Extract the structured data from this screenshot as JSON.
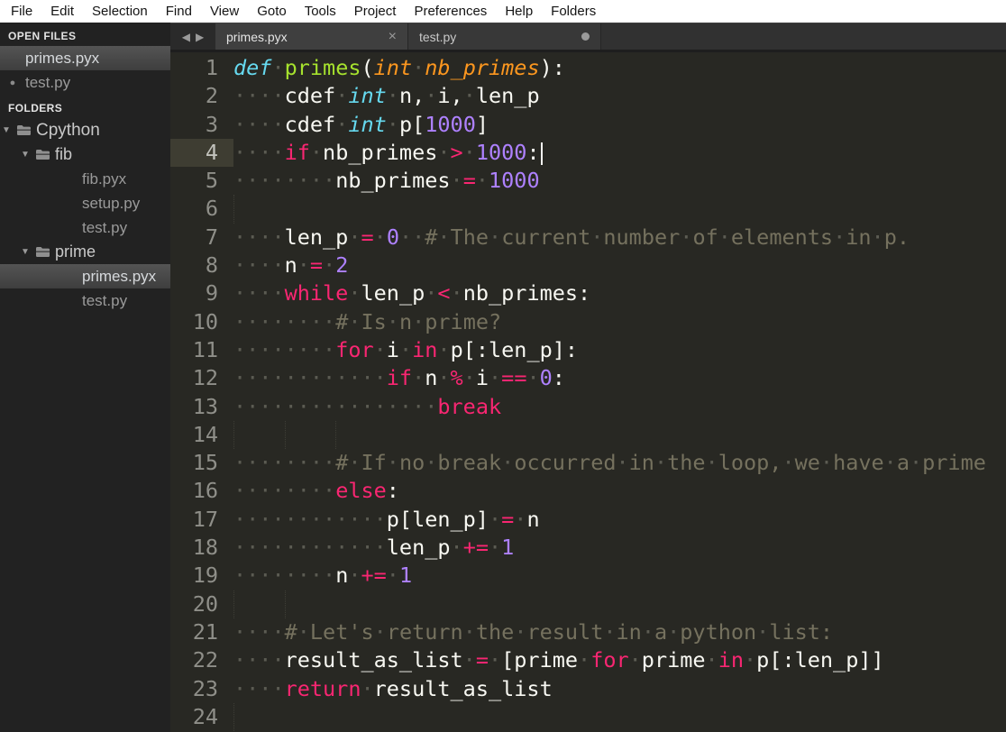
{
  "menu": {
    "items": [
      "File",
      "Edit",
      "Selection",
      "Find",
      "View",
      "Goto",
      "Tools",
      "Project",
      "Preferences",
      "Help",
      "Folders"
    ]
  },
  "icons": {
    "back": "◀",
    "forward": "▶",
    "close": "×",
    "modified_dot": "●",
    "expanded_triangle": "▼",
    "open_file_bullet": "●"
  },
  "sidebar": {
    "open_files_label": "OPEN FILES",
    "open_files": [
      {
        "name": "primes.pyx",
        "selected": true,
        "modified": false
      },
      {
        "name": "test.py",
        "selected": false,
        "modified": true
      }
    ],
    "folders_label": "FOLDERS",
    "tree": [
      {
        "label": "Cpython",
        "type": "folder",
        "depth": 0,
        "expanded": true,
        "selected": false
      },
      {
        "label": "fib",
        "type": "folder",
        "depth": 1,
        "expanded": true,
        "selected": false
      },
      {
        "label": "fib.pyx",
        "type": "file",
        "depth": 2,
        "selected": false
      },
      {
        "label": "setup.py",
        "type": "file",
        "depth": 2,
        "selected": false
      },
      {
        "label": "test.py",
        "type": "file",
        "depth": 2,
        "selected": false
      },
      {
        "label": "prime",
        "type": "folder",
        "depth": 1,
        "expanded": true,
        "selected": false
      },
      {
        "label": "primes.pyx",
        "type": "file",
        "depth": 2,
        "selected": true
      },
      {
        "label": "test.py",
        "type": "file",
        "depth": 2,
        "selected": false
      }
    ]
  },
  "tabs": {
    "items": [
      {
        "label": "primes.pyx",
        "active": true,
        "indicator": "close"
      },
      {
        "label": "test.py",
        "active": false,
        "indicator": "dot"
      }
    ]
  },
  "editor": {
    "file": "primes.pyx",
    "active_line": 4,
    "caret_line": 4,
    "ws_glyph": "·",
    "colors": {
      "background": "#282823",
      "keyword": "#f92672",
      "type_italic": "#66d9ef",
      "function_name": "#a6e22e",
      "parameter": "#fd971f",
      "number": "#ae81ff",
      "foreground": "#f8f8f2",
      "comment": "#75715e"
    },
    "lines": [
      {
        "n": 1,
        "tokens": [
          [
            "kwi",
            "def"
          ],
          [
            "t",
            " "
          ],
          [
            "fn",
            "primes"
          ],
          [
            "t",
            "("
          ],
          [
            "argi",
            "int nb_primes"
          ],
          [
            "t",
            "):"
          ]
        ]
      },
      {
        "n": 2,
        "tokens": [
          [
            "t",
            "    cdef "
          ],
          [
            "tyi",
            "int"
          ],
          [
            "t",
            " n, i, len_p"
          ]
        ]
      },
      {
        "n": 3,
        "tokens": [
          [
            "t",
            "    cdef "
          ],
          [
            "tyi",
            "int"
          ],
          [
            "t",
            " p["
          ],
          [
            "num",
            "1000"
          ],
          [
            "t",
            "]"
          ]
        ]
      },
      {
        "n": 4,
        "tokens": [
          [
            "t",
            "    "
          ],
          [
            "kw",
            "if"
          ],
          [
            "t",
            " nb_primes "
          ],
          [
            "op",
            ">"
          ],
          [
            "t",
            " "
          ],
          [
            "num",
            "1000"
          ],
          [
            "t",
            ":"
          ]
        ]
      },
      {
        "n": 5,
        "tokens": [
          [
            "t",
            "        nb_primes "
          ],
          [
            "op",
            "="
          ],
          [
            "t",
            " "
          ],
          [
            "num",
            "1000"
          ]
        ]
      },
      {
        "n": 6,
        "tokens": [],
        "guides": [
          0
        ]
      },
      {
        "n": 7,
        "tokens": [
          [
            "t",
            "    len_p "
          ],
          [
            "op",
            "="
          ],
          [
            "t",
            " "
          ],
          [
            "num",
            "0"
          ],
          [
            "t",
            "  "
          ],
          [
            "com",
            "# The current number of elements in p."
          ]
        ]
      },
      {
        "n": 8,
        "tokens": [
          [
            "t",
            "    n "
          ],
          [
            "op",
            "="
          ],
          [
            "t",
            " "
          ],
          [
            "num",
            "2"
          ]
        ]
      },
      {
        "n": 9,
        "tokens": [
          [
            "t",
            "    "
          ],
          [
            "kw",
            "while"
          ],
          [
            "t",
            " len_p "
          ],
          [
            "op",
            "<"
          ],
          [
            "t",
            " nb_primes:"
          ]
        ]
      },
      {
        "n": 10,
        "tokens": [
          [
            "t",
            "        "
          ],
          [
            "com",
            "# Is n prime?"
          ]
        ]
      },
      {
        "n": 11,
        "tokens": [
          [
            "t",
            "        "
          ],
          [
            "kw",
            "for"
          ],
          [
            "t",
            " i "
          ],
          [
            "kw",
            "in"
          ],
          [
            "t",
            " p[:len_p]:"
          ]
        ]
      },
      {
        "n": 12,
        "tokens": [
          [
            "t",
            "            "
          ],
          [
            "kw",
            "if"
          ],
          [
            "t",
            " n "
          ],
          [
            "op",
            "%"
          ],
          [
            "t",
            " i "
          ],
          [
            "op",
            "=="
          ],
          [
            "t",
            " "
          ],
          [
            "num",
            "0"
          ],
          [
            "t",
            ":"
          ]
        ]
      },
      {
        "n": 13,
        "tokens": [
          [
            "t",
            "                "
          ],
          [
            "kw",
            "break"
          ]
        ]
      },
      {
        "n": 14,
        "tokens": [],
        "guides": [
          0,
          4,
          8
        ]
      },
      {
        "n": 15,
        "tokens": [
          [
            "t",
            "        "
          ],
          [
            "com",
            "# If no break occurred in the loop, we have a prime"
          ]
        ]
      },
      {
        "n": 16,
        "tokens": [
          [
            "t",
            "        "
          ],
          [
            "kw",
            "else"
          ],
          [
            "t",
            ":"
          ]
        ]
      },
      {
        "n": 17,
        "tokens": [
          [
            "t",
            "            p[len_p] "
          ],
          [
            "op",
            "="
          ],
          [
            "t",
            " n"
          ]
        ]
      },
      {
        "n": 18,
        "tokens": [
          [
            "t",
            "            len_p "
          ],
          [
            "op",
            "+="
          ],
          [
            "t",
            " "
          ],
          [
            "num",
            "1"
          ]
        ]
      },
      {
        "n": 19,
        "tokens": [
          [
            "t",
            "        n "
          ],
          [
            "op",
            "+="
          ],
          [
            "t",
            " "
          ],
          [
            "num",
            "1"
          ]
        ]
      },
      {
        "n": 20,
        "tokens": [],
        "guides": [
          0,
          4
        ]
      },
      {
        "n": 21,
        "tokens": [
          [
            "t",
            "    "
          ],
          [
            "com",
            "# Let's return the result in a python list:"
          ]
        ]
      },
      {
        "n": 22,
        "tokens": [
          [
            "t",
            "    result_as_list "
          ],
          [
            "op",
            "="
          ],
          [
            "t",
            " [prime "
          ],
          [
            "kw",
            "for"
          ],
          [
            "t",
            " prime "
          ],
          [
            "kw",
            "in"
          ],
          [
            "t",
            " p[:len_p]]"
          ]
        ]
      },
      {
        "n": 23,
        "tokens": [
          [
            "t",
            "    "
          ],
          [
            "kw",
            "return"
          ],
          [
            "t",
            " result_as_list"
          ]
        ]
      },
      {
        "n": 24,
        "tokens": [],
        "guides": [
          0
        ]
      }
    ]
  }
}
